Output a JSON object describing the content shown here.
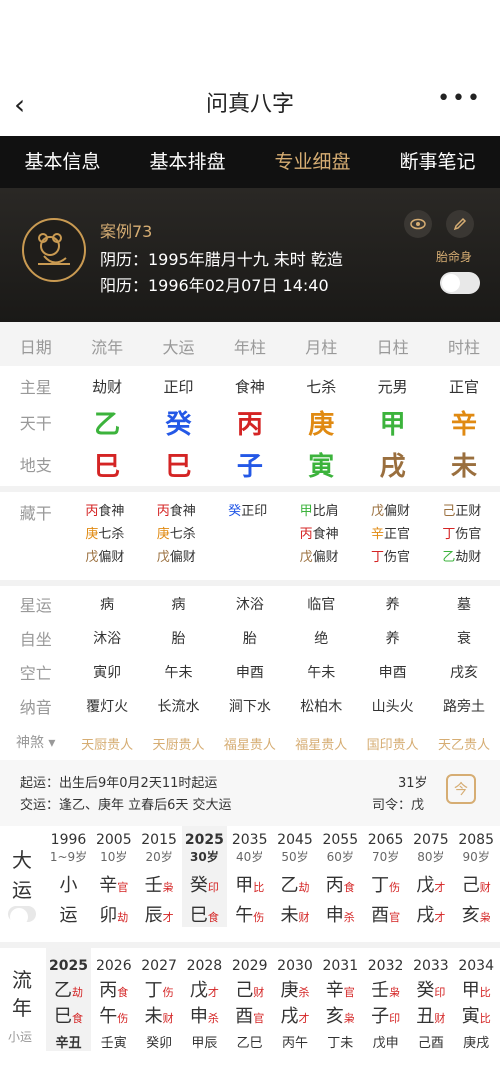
{
  "header": {
    "title": "问真八字"
  },
  "tabs": [
    "基本信息",
    "基本排盘",
    "专业细盘",
    "断事笔记"
  ],
  "profile": {
    "case": "案例73",
    "lunar": "阴历：1995年腊月十九 未时 乾造",
    "solar": "阳历：1996年02月07日 14:40",
    "taiming": "胎命身"
  },
  "cols": [
    "日期",
    "流年",
    "大运",
    "年柱",
    "月柱",
    "日柱",
    "时柱"
  ],
  "zhuxing": [
    "主星",
    "劫财",
    "正印",
    "食神",
    "七杀",
    "元男",
    "正官"
  ],
  "tiangan": {
    "label": "天干",
    "chars": [
      "乙",
      "癸",
      "丙",
      "庚",
      "甲",
      "辛"
    ],
    "colors": [
      "#3cb33c",
      "#2458e6",
      "#d42424",
      "#e08a12",
      "#3cb33c",
      "#e08a12"
    ]
  },
  "dizhi": {
    "label": "地支",
    "chars": [
      "巳",
      "巳",
      "子",
      "寅",
      "戌",
      "未"
    ],
    "colors": [
      "#d42424",
      "#d42424",
      "#2458e6",
      "#3cb33c",
      "#9a6f3e",
      "#9a6f3e"
    ]
  },
  "canggan": {
    "label": "藏干",
    "cols": [
      [
        [
          "丙",
          "食神",
          "#d42424"
        ],
        [
          "庚",
          "七杀",
          "#e08a12"
        ],
        [
          "戊",
          "偏财",
          "#9a6f3e"
        ]
      ],
      [
        [
          "丙",
          "食神",
          "#d42424"
        ],
        [
          "庚",
          "七杀",
          "#e08a12"
        ],
        [
          "戊",
          "偏财",
          "#9a6f3e"
        ]
      ],
      [
        [
          "癸",
          "正印",
          "#2458e6"
        ]
      ],
      [
        [
          "甲",
          "比肩",
          "#3cb33c"
        ],
        [
          "丙",
          "食神",
          "#d42424"
        ],
        [
          "戊",
          "偏财",
          "#9a6f3e"
        ]
      ],
      [
        [
          "戊",
          "偏财",
          "#9a6f3e"
        ],
        [
          "辛",
          "正官",
          "#e08a12"
        ],
        [
          "丁",
          "伤官",
          "#d42424"
        ]
      ],
      [
        [
          "己",
          "正财",
          "#9a6f3e"
        ],
        [
          "丁",
          "伤官",
          "#d42424"
        ],
        [
          "乙",
          "劫财",
          "#3cb33c"
        ]
      ]
    ]
  },
  "rows": [
    {
      "label": "星运",
      "vals": [
        "病",
        "病",
        "沐浴",
        "临官",
        "养",
        "墓"
      ]
    },
    {
      "label": "自坐",
      "vals": [
        "沐浴",
        "胎",
        "胎",
        "绝",
        "养",
        "衰"
      ]
    },
    {
      "label": "空亡",
      "vals": [
        "寅卯",
        "午未",
        "申酉",
        "午未",
        "申酉",
        "戌亥"
      ]
    },
    {
      "label": "纳音",
      "vals": [
        "覆灯火",
        "长流水",
        "涧下水",
        "松柏木",
        "山头火",
        "路旁土"
      ]
    }
  ],
  "shensha": {
    "label": "神煞",
    "vals": [
      "天厨贵人",
      "天厨贵人",
      "福星贵人",
      "福星贵人",
      "国印贵人",
      "天乙贵人"
    ]
  },
  "info": {
    "qiyun": "起运：出生后9年0月2天11时起运",
    "jiaoyun": "交运：逢乙、庚年 立春后6天 交大运",
    "age": "31岁",
    "siling": "司令：戊",
    "cal": "今"
  },
  "dayun": {
    "label": "大运",
    "cols": [
      {
        "y": "1996",
        "a": "1~9岁",
        "g1": "小",
        "g2": "运"
      },
      {
        "y": "2005",
        "a": "10岁",
        "g1": "辛",
        "s1": "官",
        "g2": "卯",
        "s2": "劫"
      },
      {
        "y": "2015",
        "a": "20岁",
        "g1": "壬",
        "s1": "枭",
        "g2": "辰",
        "s2": "才"
      },
      {
        "y": "2025",
        "a": "30岁",
        "g1": "癸",
        "s1": "印",
        "g2": "巳",
        "s2": "食"
      },
      {
        "y": "2035",
        "a": "40岁",
        "g1": "甲",
        "s1": "比",
        "g2": "午",
        "s2": "伤"
      },
      {
        "y": "2045",
        "a": "50岁",
        "g1": "乙",
        "s1": "劫",
        "g2": "未",
        "s2": "财"
      },
      {
        "y": "2055",
        "a": "60岁",
        "g1": "丙",
        "s1": "食",
        "g2": "申",
        "s2": "杀"
      },
      {
        "y": "2065",
        "a": "70岁",
        "g1": "丁",
        "s1": "伤",
        "g2": "酉",
        "s2": "官"
      },
      {
        "y": "2075",
        "a": "80岁",
        "g1": "戊",
        "s1": "才",
        "g2": "戌",
        "s2": "才"
      },
      {
        "y": "2085",
        "a": "90岁",
        "g1": "己",
        "s1": "财",
        "g2": "亥",
        "s2": "枭"
      }
    ]
  },
  "liunian": {
    "label": "流年",
    "xiaoyun": "小运",
    "cols": [
      {
        "y": "2025",
        "g1": "乙",
        "s1": "劫",
        "g2": "巳",
        "s2": "食",
        "b": "辛丑"
      },
      {
        "y": "2026",
        "g1": "丙",
        "s1": "食",
        "g2": "午",
        "s2": "伤",
        "b": "壬寅"
      },
      {
        "y": "2027",
        "g1": "丁",
        "s1": "伤",
        "g2": "未",
        "s2": "财",
        "b": "癸卯"
      },
      {
        "y": "2028",
        "g1": "戊",
        "s1": "才",
        "g2": "申",
        "s2": "杀",
        "b": "甲辰"
      },
      {
        "y": "2029",
        "g1": "己",
        "s1": "财",
        "g2": "酉",
        "s2": "官",
        "b": "乙巳"
      },
      {
        "y": "2030",
        "g1": "庚",
        "s1": "杀",
        "g2": "戌",
        "s2": "才",
        "b": "丙午"
      },
      {
        "y": "2031",
        "g1": "辛",
        "s1": "官",
        "g2": "亥",
        "s2": "枭",
        "b": "丁未"
      },
      {
        "y": "2032",
        "g1": "壬",
        "s1": "枭",
        "g2": "子",
        "s2": "印",
        "b": "戊申"
      },
      {
        "y": "2033",
        "g1": "癸",
        "s1": "印",
        "g2": "丑",
        "s2": "财",
        "b": "己酉"
      },
      {
        "y": "2034",
        "g1": "甲",
        "s1": "比",
        "g2": "寅",
        "s2": "比",
        "b": "庚戌"
      }
    ]
  }
}
